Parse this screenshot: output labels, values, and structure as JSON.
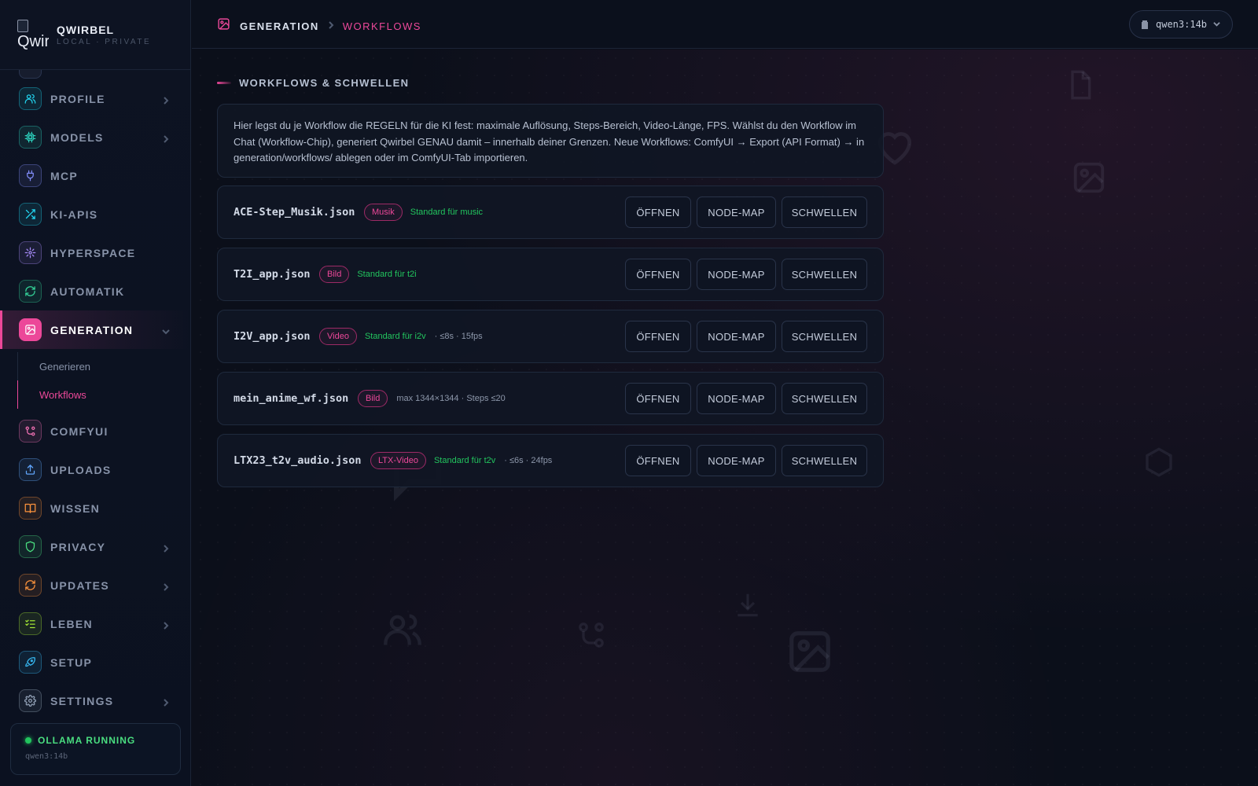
{
  "brand": {
    "logo_alt": "Qwir",
    "name": "QWIRBEL",
    "subtitle": "LOCAL · PRIVATE"
  },
  "nav": [
    {
      "id": "profile",
      "label": "PROFILE",
      "icon": "users-icon",
      "color": "#22d3ee",
      "chevron": true
    },
    {
      "id": "models",
      "label": "MODELS",
      "icon": "chip-icon",
      "color": "#2dd4bf",
      "chevron": true
    },
    {
      "id": "mcp",
      "label": "MCP",
      "icon": "plug-icon",
      "color": "#818cf8",
      "chevron": false
    },
    {
      "id": "ki-apis",
      "label": "KI-APIS",
      "icon": "shuffle-icon",
      "color": "#22d3ee",
      "chevron": false
    },
    {
      "id": "hyperspace",
      "label": "HYPERSPACE",
      "icon": "sparkle-icon",
      "color": "#a78bfa",
      "chevron": false
    },
    {
      "id": "automatik",
      "label": "AUTOMATIK",
      "icon": "refresh-icon",
      "color": "#34d399",
      "chevron": false
    },
    {
      "id": "generation",
      "label": "GENERATION",
      "icon": "image-icon",
      "color": "#ec4899",
      "chevron": true,
      "expanded": true,
      "children": [
        {
          "label": "Generieren"
        },
        {
          "label": "Workflows",
          "active": true
        }
      ]
    },
    {
      "id": "comfyui",
      "label": "COMFYUI",
      "icon": "nodes-icon",
      "color": "#f472b6",
      "chevron": false
    },
    {
      "id": "uploads",
      "label": "UPLOADS",
      "icon": "upload-icon",
      "color": "#60a5fa",
      "chevron": false
    },
    {
      "id": "wissen",
      "label": "WISSEN",
      "icon": "book-icon",
      "color": "#fb923c",
      "chevron": false
    },
    {
      "id": "privacy",
      "label": "PRIVACY",
      "icon": "shield-icon",
      "color": "#4ade80",
      "chevron": true
    },
    {
      "id": "updates",
      "label": "UPDATES",
      "icon": "refresh-icon",
      "color": "#fb923c",
      "chevron": true
    },
    {
      "id": "leben",
      "label": "LEBEN",
      "icon": "checklist-icon",
      "color": "#a3e635",
      "chevron": true
    },
    {
      "id": "setup",
      "label": "SETUP",
      "icon": "rocket-icon",
      "color": "#38bdf8",
      "chevron": false
    },
    {
      "id": "settings",
      "label": "SETTINGS",
      "icon": "gear-icon",
      "color": "#94a3b8",
      "chevron": true
    }
  ],
  "status": {
    "label": "OLLAMA RUNNING",
    "model": "qwen3:14b",
    "color": "#22c55e"
  },
  "header": {
    "breadcrumb": [
      "GENERATION",
      "WORKFLOWS"
    ],
    "model_selector": "qwen3:14b"
  },
  "main": {
    "section_title": "WORKFLOWS & SCHWELLEN",
    "info_text": "Hier legst du je Workflow die REGELN für die KI fest: maximale Auflösung, Steps-Bereich, Video-Länge, FPS. Wählst du den Workflow im Chat (Workflow-Chip), generiert Qwirbel GENAU damit – innerhalb deiner Grenzen. Neue Workflows: ComfyUI → Export (API Format) → in generation/workflows/ ablegen oder im ComfyUI-Tab importieren.",
    "buttons": {
      "open": "ÖFFNEN",
      "node_map": "NODE-MAP",
      "thresholds": "SCHWELLEN"
    },
    "workflows": [
      {
        "file": "ACE-Step_Musik.json",
        "badge": "Musik",
        "standard": "Standard für music",
        "extra": ""
      },
      {
        "file": "T2I_app.json",
        "badge": "Bild",
        "standard": "Standard für t2i",
        "extra": ""
      },
      {
        "file": "I2V_app.json",
        "badge": "Video",
        "standard": "Standard für i2v",
        "extra": "· ≤8s · 15fps"
      },
      {
        "file": "mein_anime_wf.json",
        "badge": "Bild",
        "standard": "",
        "extra": "max 1344×1344 · Steps ≤20"
      },
      {
        "file": "LTX23_t2v_audio.json",
        "badge": "LTX-Video",
        "standard": "Standard für t2v",
        "extra": "· ≤6s · 24fps"
      }
    ]
  },
  "accent_color": "#ec4899"
}
